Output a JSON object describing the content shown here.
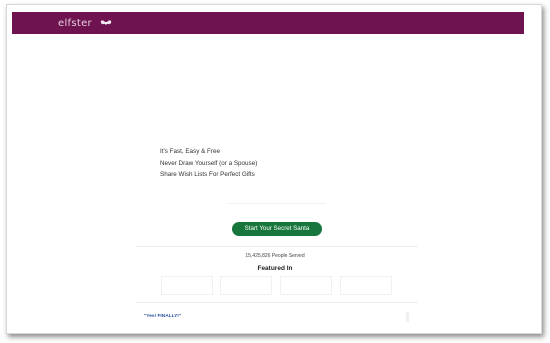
{
  "header": {
    "logo_text": "elfster",
    "logo_icon": "gift-bow-icon",
    "bar_color": "#6e1350"
  },
  "hero": {
    "features": [
      "It's Fast, Easy & Free",
      "Never Draw Yourself (or a Spouse)",
      "Share Wish Lists For Perfect Gifts"
    ],
    "cta_label": "Start Your Secret Santa",
    "cta_color": "#17763c"
  },
  "stats": {
    "served_text": "15,425,826 People Served"
  },
  "featured": {
    "title": "Featured In",
    "logo_slots": 4
  },
  "testimonial": {
    "text": "\"Yes! FINALLY!\""
  }
}
